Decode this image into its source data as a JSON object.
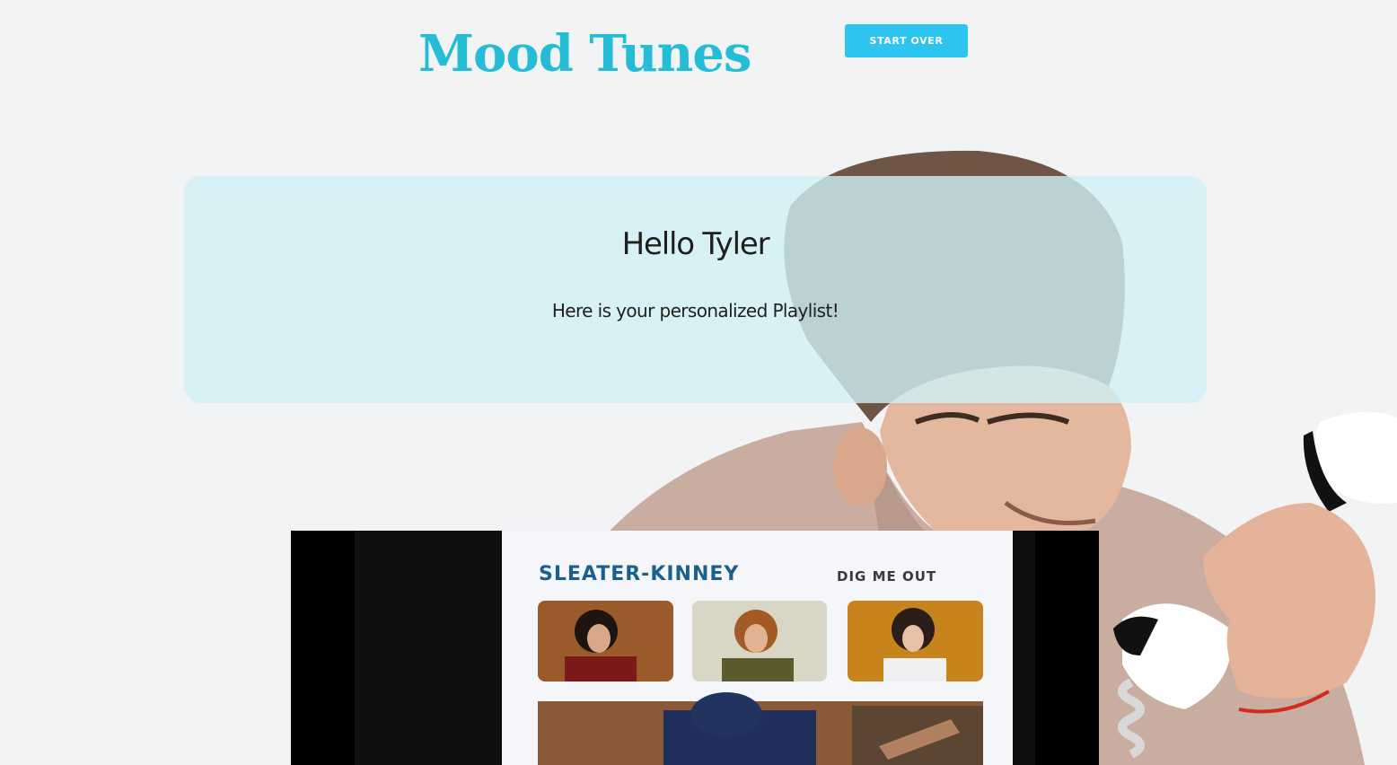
{
  "header": {
    "title": "Mood Tunes",
    "start_over_label": "START OVER"
  },
  "greeting": {
    "title": "Hello Tyler",
    "subtitle": "Here is your personalized Playlist!"
  },
  "video": {
    "album_artist": "SLEATER-KINNEY",
    "album_title": "DIG ME OUT"
  },
  "colors": {
    "brand": "#25bcd6",
    "button": "#2ec4f0",
    "card": "#d0f0f6"
  }
}
